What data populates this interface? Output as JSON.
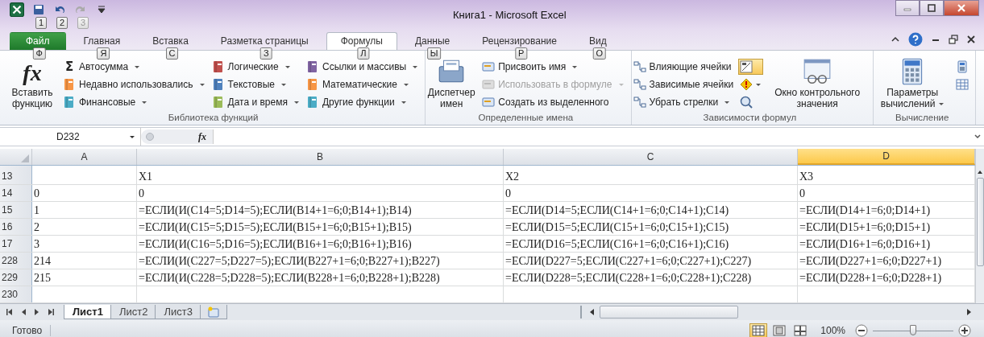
{
  "window": {
    "title": "Книга1 - Microsoft Excel"
  },
  "quick_access": [
    {
      "keytip": "1",
      "disabled": false
    },
    {
      "keytip": "2",
      "disabled": false
    },
    {
      "keytip": "3",
      "disabled": true
    }
  ],
  "tabs": [
    {
      "label": "Файл",
      "keytip": "Ф",
      "kind": "file",
      "selected": false
    },
    {
      "label": "Главная",
      "keytip": "Я",
      "kind": "tab",
      "selected": false
    },
    {
      "label": "Вставка",
      "keytip": "С",
      "kind": "tab",
      "selected": false
    },
    {
      "label": "Разметка страницы",
      "keytip": "З",
      "kind": "tab",
      "selected": false
    },
    {
      "label": "Формулы",
      "keytip": "Л",
      "kind": "tab",
      "selected": true
    },
    {
      "label": "Данные",
      "keytip": "Ы",
      "kind": "tab",
      "selected": false
    },
    {
      "label": "Рецензирование",
      "keytip": "Р",
      "kind": "tab",
      "selected": false
    },
    {
      "label": "Вид",
      "keytip": "О",
      "kind": "tab",
      "selected": false
    }
  ],
  "ribbon_groups": [
    {
      "label": "Библиотека функций",
      "kind": "library",
      "columns": [
        {
          "kind": "large",
          "label": "Вставить функцию",
          "glyph": "fx",
          "dropdown": false
        },
        {
          "kind": "stack",
          "items": [
            {
              "label": "Автосумма",
              "glyph": "Σ",
              "dropdown": true,
              "disabled": false
            },
            {
              "label": "Недавно использовались",
              "dropdown": true,
              "disabled": false
            },
            {
              "label": "Финансовые",
              "dropdown": true,
              "disabled": false
            }
          ]
        },
        {
          "kind": "stack",
          "items": [
            {
              "label": "Логические",
              "dropdown": true,
              "disabled": false
            },
            {
              "label": "Текстовые",
              "dropdown": true,
              "disabled": false
            },
            {
              "label": "Дата и время",
              "dropdown": true,
              "disabled": false
            }
          ]
        },
        {
          "kind": "stack",
          "items": [
            {
              "label": "Ссылки и массивы",
              "dropdown": true,
              "disabled": false
            },
            {
              "label": "Математические",
              "dropdown": true,
              "disabled": false
            },
            {
              "label": "Другие функции",
              "dropdown": true,
              "disabled": false
            }
          ]
        }
      ]
    },
    {
      "label": "Определенные имена",
      "kind": "names",
      "columns": [
        {
          "kind": "large",
          "label": "Диспетчер имен",
          "dropdown": false
        },
        {
          "kind": "stack",
          "items": [
            {
              "label": "Присвоить имя",
              "dropdown": true,
              "disabled": false
            },
            {
              "label": "Использовать в формуле",
              "dropdown": true,
              "disabled": true
            },
            {
              "label": "Создать из выделенного",
              "dropdown": false,
              "disabled": false
            }
          ]
        }
      ]
    },
    {
      "label": "Зависимости формул",
      "kind": "auditing",
      "columns": [
        {
          "kind": "stack",
          "items": [
            {
              "label": "Влияющие ячейки",
              "dropdown": false,
              "disabled": false
            },
            {
              "label": "Зависимые ячейки",
              "dropdown": false,
              "disabled": false
            },
            {
              "label": "Убрать стрелки",
              "dropdown": true,
              "disabled": false
            }
          ]
        },
        {
          "kind": "icons",
          "items": [
            {
              "on": true,
              "dropdown": false
            },
            {
              "on": false,
              "dropdown": true
            },
            {
              "on": false,
              "dropdown": false
            }
          ]
        },
        {
          "kind": "large",
          "label": "Окно контрольного значения",
          "dropdown": false
        }
      ]
    },
    {
      "label": "Вычисление",
      "kind": "calculation",
      "columns": [
        {
          "kind": "large",
          "label": "Параметры вычислений",
          "dropdown": true
        },
        {
          "kind": "icons",
          "items": [
            {
              "on": false,
              "dropdown": false
            },
            {
              "on": false,
              "dropdown": false
            }
          ]
        }
      ]
    }
  ],
  "formula_bar": {
    "name_box": "D232",
    "fx": "fx"
  },
  "columns": [
    {
      "label": "A",
      "selected": false
    },
    {
      "label": "B",
      "selected": false
    },
    {
      "label": "C",
      "selected": false
    },
    {
      "label": "D",
      "selected": true
    }
  ],
  "rows": [
    {
      "number": "13",
      "cells": [
        null,
        "X1",
        "X2",
        "X3"
      ]
    },
    {
      "number": "14",
      "cells": [
        "0",
        "0",
        "0",
        "0"
      ]
    },
    {
      "number": "15",
      "cells": [
        "1",
        "=ЕСЛИ(И(C14=5;D14=5);ЕСЛИ(B14+1=6;0;B14+1);B14)",
        "=ЕСЛИ(D14=5;ЕСЛИ(C14+1=6;0;C14+1);C14)",
        "=ЕСЛИ(D14+1=6;0;D14+1)"
      ]
    },
    {
      "number": "16",
      "cells": [
        "2",
        "=ЕСЛИ(И(C15=5;D15=5);ЕСЛИ(B15+1=6;0;B15+1);B15)",
        "=ЕСЛИ(D15=5;ЕСЛИ(C15+1=6;0;C15+1);C15)",
        "=ЕСЛИ(D15+1=6;0;D15+1)"
      ]
    },
    {
      "number": "17",
      "cells": [
        "3",
        "=ЕСЛИ(И(C16=5;D16=5);ЕСЛИ(B16+1=6;0;B16+1);B16)",
        "=ЕСЛИ(D16=5;ЕСЛИ(C16+1=6;0;C16+1);C16)",
        "=ЕСЛИ(D16+1=6;0;D16+1)"
      ]
    },
    {
      "number": "228",
      "cells": [
        "214",
        "=ЕСЛИ(И(C227=5;D227=5);ЕСЛИ(B227+1=6;0;B227+1);B227)",
        "=ЕСЛИ(D227=5;ЕСЛИ(C227+1=6;0;C227+1);C227)",
        "=ЕСЛИ(D227+1=6;0;D227+1)"
      ]
    },
    {
      "number": "229",
      "cells": [
        "215",
        "=ЕСЛИ(И(C228=5;D228=5);ЕСЛИ(B228+1=6;0;B228+1);B228)",
        "=ЕСЛИ(D228=5;ЕСЛИ(C228+1=6;0;C228+1);C228)",
        "=ЕСЛИ(D228+1=6;0;D228+1)"
      ]
    },
    {
      "number": "230",
      "cells": [
        null,
        null,
        null,
        null
      ]
    }
  ],
  "sheets": [
    {
      "label": "Лист1",
      "selected": true
    },
    {
      "label": "Лист2",
      "selected": false
    },
    {
      "label": "Лист3",
      "selected": false
    }
  ],
  "status_bar": {
    "text": "Готово",
    "views": [
      {
        "selected": true
      },
      {
        "selected": false
      },
      {
        "selected": false
      }
    ],
    "zoom": "100%",
    "zoom_slider": {
      "level": 0.5
    }
  }
}
